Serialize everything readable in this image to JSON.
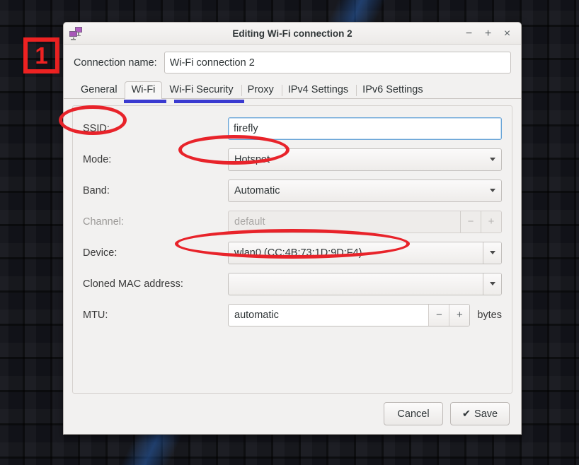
{
  "annotation": {
    "badge_number": "1",
    "highlight_color": "#e8232a",
    "highlights": [
      "SSID:",
      "Hotspot",
      "wlan0 (CC:4B:73:1D:9D:F4)"
    ]
  },
  "window": {
    "title": "Editing Wi-Fi connection 2",
    "icon": "network-connection-editor-icon",
    "controls": {
      "minimize": "−",
      "maximize": "+",
      "close": "×"
    }
  },
  "connection": {
    "name_label": "Connection name:",
    "name_value": "Wi-Fi connection 2"
  },
  "tabs": [
    {
      "label": "General",
      "active": false
    },
    {
      "label": "Wi-Fi",
      "active": true
    },
    {
      "label": "Wi-Fi Security",
      "active": false
    },
    {
      "label": "Proxy",
      "active": false
    },
    {
      "label": "IPv4 Settings",
      "active": false
    },
    {
      "label": "IPv6 Settings",
      "active": false
    }
  ],
  "form": {
    "ssid": {
      "label": "SSID:",
      "value": "firefly",
      "focused": true
    },
    "mode": {
      "label": "Mode:",
      "value": "Hotspot"
    },
    "band": {
      "label": "Band:",
      "value": "Automatic"
    },
    "channel": {
      "label": "Channel:",
      "value": "default",
      "disabled": true,
      "minus": "−",
      "plus": "+"
    },
    "device": {
      "label": "Device:",
      "value": "wlan0 (CC:4B:73:1D:9D:F4)"
    },
    "cloned_mac": {
      "label": "Cloned MAC address:",
      "value": ""
    },
    "mtu": {
      "label": "MTU:",
      "value": "automatic",
      "minus": "−",
      "plus": "+",
      "unit": "bytes"
    }
  },
  "actions": {
    "cancel": "Cancel",
    "save": "Save",
    "save_check": "✔"
  }
}
